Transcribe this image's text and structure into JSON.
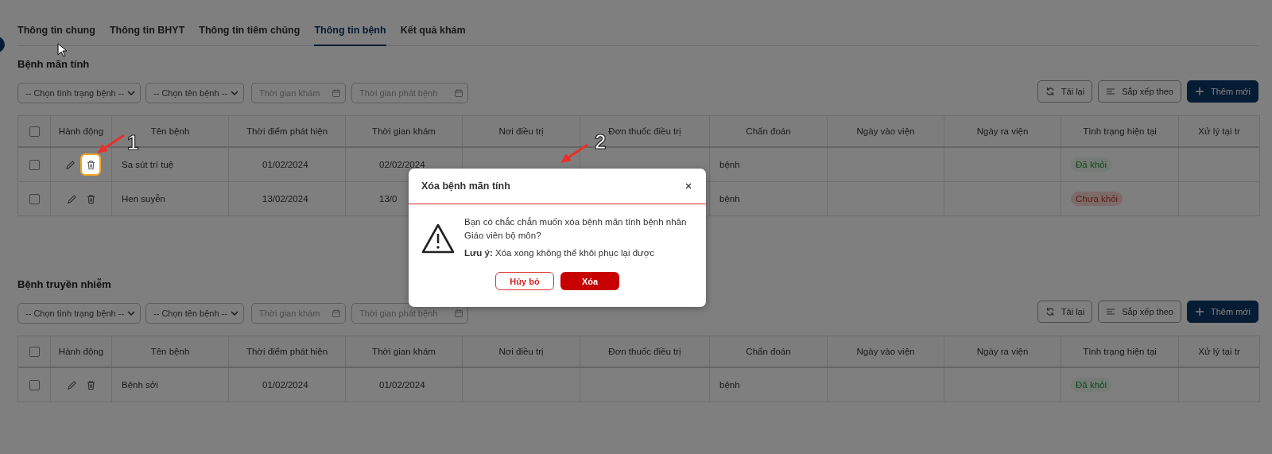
{
  "tabs": [
    {
      "label": "Thông tin chung",
      "selected": false
    },
    {
      "label": "Thông tin BHYT",
      "selected": false
    },
    {
      "label": "Thông tin tiêm chủng",
      "selected": false
    },
    {
      "label": "Thông tin bệnh",
      "selected": true
    },
    {
      "label": "Kết quả khám",
      "selected": false
    }
  ],
  "sections": [
    {
      "title": "Bệnh mãn tính",
      "filters": [
        {
          "kind": "select",
          "placeholder": "-- Chọn tình trạng bệnh --"
        },
        {
          "kind": "select",
          "placeholder": "-- Chọn tên bệnh --"
        },
        {
          "kind": "date",
          "placeholder": "Thời gian khám"
        },
        {
          "kind": "date",
          "placeholder": "Thời gian phát bệnh"
        }
      ],
      "actions": [
        {
          "kind": "reload",
          "label": "Tải lại"
        },
        {
          "kind": "sort",
          "label": "Sắp xếp theo"
        },
        {
          "kind": "add",
          "label": "Thêm mới"
        }
      ],
      "table": {
        "header_checked": false,
        "columns": [
          "Hành động",
          "Tên bệnh",
          "Thời điểm phát hiện",
          "Thời gian khám",
          "Nơi điều trị",
          "Đơn thuốc điều trị",
          "Chẩn đoán",
          "Ngày vào viện",
          "Ngày ra viện",
          "Tình trạng hiện tại",
          "Xử lý tại tr"
        ],
        "rows": [
          {
            "checked": false,
            "delete_highlighted": true,
            "name": "Sa sút trí tuệ",
            "detected": "01/02/2024",
            "exam_time": "02/02/2024",
            "diagnosis": "bệnh",
            "status": {
              "kind": "cured",
              "label": "Đã khỏi"
            }
          },
          {
            "checked": false,
            "delete_highlighted": false,
            "name": "Hen suyễn",
            "detected": "13/02/2024",
            "exam_time": "13/0",
            "diagnosis": "bệnh",
            "status": {
              "kind": "not_cured",
              "label": "Chưa khỏi"
            }
          }
        ]
      }
    },
    {
      "title": "Bệnh truyền nhiễm",
      "filters": [
        {
          "kind": "select",
          "placeholder": "-- Chọn tình trạng bệnh --"
        },
        {
          "kind": "select",
          "placeholder": "-- Chọn tên bệnh --"
        },
        {
          "kind": "date",
          "placeholder": "Thời gian khám"
        },
        {
          "kind": "date",
          "placeholder": "Thời gian phát bệnh"
        }
      ],
      "actions": [
        {
          "kind": "reload",
          "label": "Tải lại"
        },
        {
          "kind": "sort",
          "label": "Sắp xếp theo"
        },
        {
          "kind": "add",
          "label": "Thêm mới"
        }
      ],
      "table": {
        "header_checked": false,
        "columns": [
          "Hành động",
          "Tên bệnh",
          "Thời điểm phát hiện",
          "Thời gian khám",
          "Nơi điều trị",
          "Đơn thuốc điều trị",
          "Chẩn đoán",
          "Ngày vào viện",
          "Ngày ra viện",
          "Tình trạng hiện tại",
          "Xử lý tại tr"
        ],
        "rows": [
          {
            "checked": false,
            "delete_highlighted": false,
            "name": "Bệnh sởi",
            "detected": "01/02/2024",
            "exam_time": "01/02/2024",
            "diagnosis": "bệnh",
            "status": {
              "kind": "cured",
              "label": "Đã khỏi"
            }
          }
        ]
      }
    }
  ],
  "dialog": {
    "title": "Xóa bệnh mãn tính",
    "message": "Bạn có chắc chắn muốn xóa bệnh mãn tính bệnh nhân Giáo viên bộ môn?",
    "note": "**Lưu ý:** Xóa xong không thể khôi phục lại được",
    "buttons": [
      {
        "kind": "cancel",
        "label": "Hủy bỏ"
      },
      {
        "kind": "confirm",
        "label": "Xóa"
      }
    ]
  },
  "annotations": [
    {
      "label": "1"
    },
    {
      "label": "2"
    }
  ]
}
